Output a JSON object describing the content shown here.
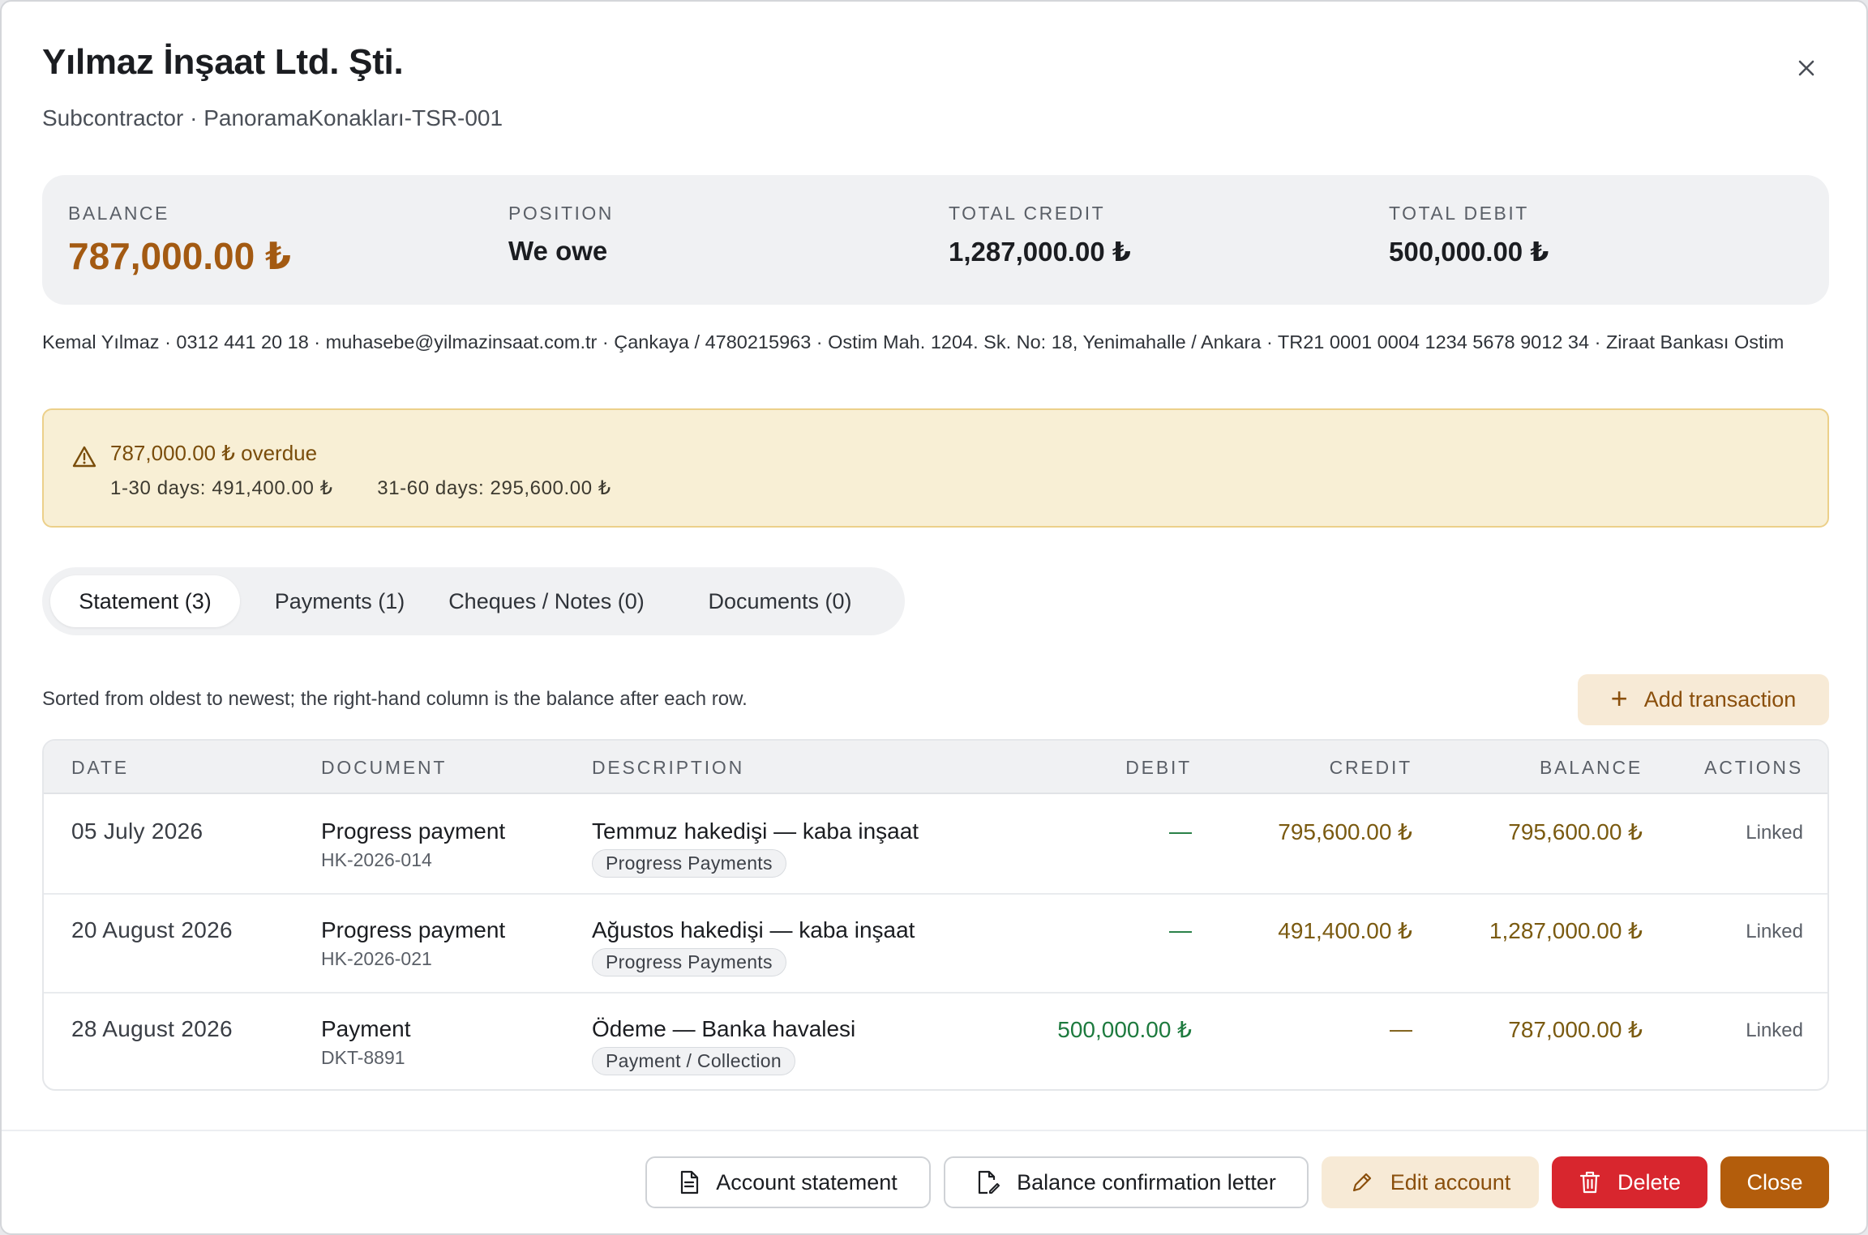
{
  "dialog": {
    "title": "Yılmaz İnşaat Ltd. Şti.",
    "subtitle": "Subcontractor · PanoramaKonakları-TSR-001"
  },
  "summary": {
    "balance_label": "BALANCE",
    "balance_value": "787,000.00 ₺",
    "position_label": "POSITION",
    "position_value": "We owe",
    "total_credit_label": "TOTAL CREDIT",
    "total_credit_value": "1,287,000.00 ₺",
    "total_debit_label": "TOTAL DEBIT",
    "total_debit_value": "500,000.00 ₺"
  },
  "contact_line": "Kemal Yılmaz · 0312 441 20 18 · muhasebe@yilmazinsaat.com.tr · Çankaya / 4780215963 · Ostim Mah. 1204. Sk. No: 18, Yenimahalle / Ankara · TR21 0001 0004 1234 5678 9012 34 · Ziraat Bankası Ostim",
  "alert": {
    "title": "787,000.00 ₺ overdue",
    "bucket_1": "1-30 days: 491,400.00 ₺",
    "bucket_2": "31-60 days: 295,600.00 ₺"
  },
  "tabs": [
    {
      "label": "Statement (3)"
    },
    {
      "label": "Payments (1)"
    },
    {
      "label": "Cheques / Notes (0)"
    },
    {
      "label": "Documents (0)"
    }
  ],
  "statement": {
    "hint": "Sorted from oldest to newest; the right-hand column is the balance after each row.",
    "add_label": "Add transaction",
    "columns": {
      "date": "DATE",
      "document": "DOCUMENT",
      "description": "DESCRIPTION",
      "debit": "DEBIT",
      "credit": "CREDIT",
      "balance": "BALANCE",
      "actions": "ACTIONS"
    },
    "rows": [
      {
        "date": "05 July 2026",
        "doc_type": "Progress payment",
        "doc_no": "HK-2026-014",
        "description": "Temmuz hakedişi — kaba inşaat",
        "tag": "Progress Payments",
        "debit": "—",
        "credit": "795,600.00 ₺",
        "balance": "795,600.00 ₺",
        "action": "Linked"
      },
      {
        "date": "20 August 2026",
        "doc_type": "Progress payment",
        "doc_no": "HK-2026-021",
        "description": "Ağustos hakedişi — kaba inşaat",
        "tag": "Progress Payments",
        "debit": "—",
        "credit": "491,400.00 ₺",
        "balance": "1,287,000.00 ₺",
        "action": "Linked"
      },
      {
        "date": "28 August 2026",
        "doc_type": "Payment",
        "doc_no": "DKT-8891",
        "description": "Ödeme — Banka havalesi",
        "tag": "Payment / Collection",
        "debit": "500,000.00 ₺",
        "credit": "—",
        "balance": "787,000.00 ₺",
        "action": "Linked"
      }
    ]
  },
  "footer": {
    "account_statement": "Account statement",
    "balance_confirmation": "Balance confirmation letter",
    "edit_account": "Edit account",
    "delete": "Delete",
    "close": "Close"
  },
  "colors": {
    "accent": "#b35d0c",
    "balance_text": "#a35a12",
    "danger": "#d8262e",
    "debit_green": "#1d7a3e",
    "alert_bg": "#f8efd5"
  }
}
